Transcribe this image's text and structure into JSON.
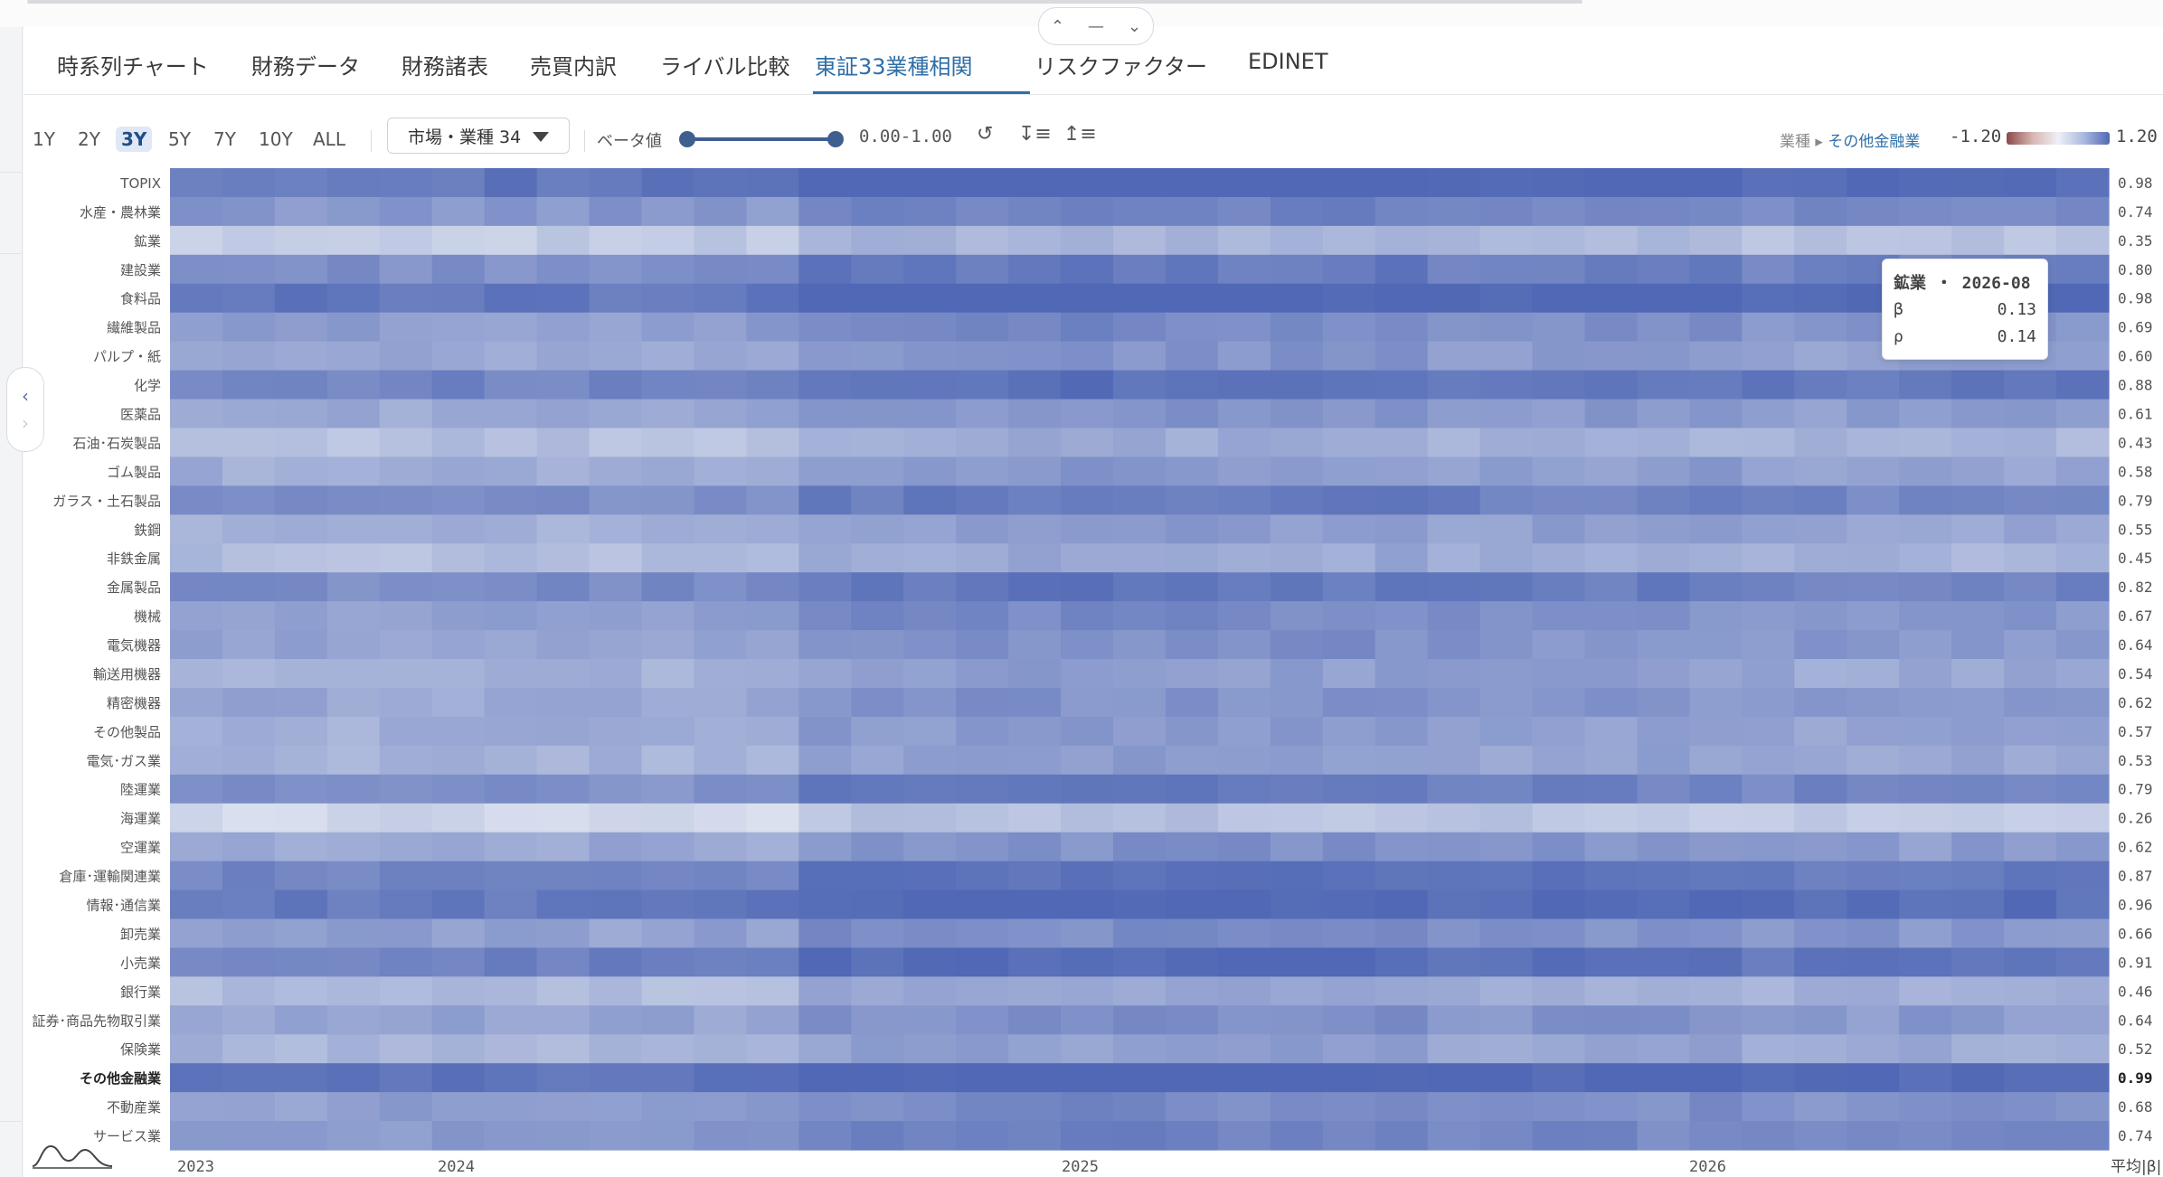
{
  "window": {
    "collapse_icons": [
      "chevron-up-icon",
      "dash-icon",
      "chevron-down-icon"
    ],
    "side_icons": [
      "chevron-left-icon",
      "chevron-right-icon"
    ]
  },
  "tabs": [
    {
      "label": "時系列チャート"
    },
    {
      "label": "財務データ"
    },
    {
      "label": "財務諸表"
    },
    {
      "label": "売買内訳"
    },
    {
      "label": "ライバル比較"
    },
    {
      "label": "東証33業種相関",
      "active": true
    },
    {
      "label": "リスクファクター"
    },
    {
      "label": "EDINET"
    }
  ],
  "toolbar": {
    "ranges": [
      "1Y",
      "2Y",
      "3Y",
      "5Y",
      "7Y",
      "10Y",
      "ALL"
    ],
    "active_range": "3Y",
    "market_select": "市場・業種 34",
    "beta_label": "ベータ値",
    "beta_range": [
      0.0,
      1.0
    ],
    "beta_range_text": "0.00-1.00",
    "icons": [
      "reset-icon",
      "sort-desc-icon",
      "sort-asc-icon"
    ],
    "legend_prefix": "業種",
    "legend_sector": "その他金融業",
    "legend_min": "-1.20",
    "legend_max": "1.20"
  },
  "tooltip": {
    "title": "鉱業 ・ 2026-08",
    "beta_label": "β",
    "beta_value": "0.13",
    "rho_label": "ρ",
    "rho_value": "0.14"
  },
  "chart_data": {
    "type": "heatmap",
    "xlabel_right": "平均|β|",
    "x_ticks": [
      "2023",
      "2024",
      "2025",
      "2026"
    ],
    "color_range": [
      -1.2,
      1.2
    ],
    "selected_row": "その他金融業",
    "rows": [
      {
        "label": "TOPIX",
        "mean": "0.98"
      },
      {
        "label": "水産・農林業",
        "mean": "0.74"
      },
      {
        "label": "鉱業",
        "mean": "0.35"
      },
      {
        "label": "建設業",
        "mean": "0.80"
      },
      {
        "label": "食料品",
        "mean": "0.98"
      },
      {
        "label": "繊維製品",
        "mean": "0.69"
      },
      {
        "label": "パルプ・紙",
        "mean": "0.60"
      },
      {
        "label": "化学",
        "mean": "0.88"
      },
      {
        "label": "医薬品",
        "mean": "0.61"
      },
      {
        "label": "石油･石炭製品",
        "mean": "0.43"
      },
      {
        "label": "ゴム製品",
        "mean": "0.58"
      },
      {
        "label": "ガラス・土石製品",
        "mean": "0.79"
      },
      {
        "label": "鉄鋼",
        "mean": "0.55"
      },
      {
        "label": "非鉄金属",
        "mean": "0.45"
      },
      {
        "label": "金属製品",
        "mean": "0.82"
      },
      {
        "label": "機械",
        "mean": "0.67"
      },
      {
        "label": "電気機器",
        "mean": "0.64"
      },
      {
        "label": "輸送用機器",
        "mean": "0.54"
      },
      {
        "label": "精密機器",
        "mean": "0.62"
      },
      {
        "label": "その他製品",
        "mean": "0.57"
      },
      {
        "label": "電気･ガス業",
        "mean": "0.53"
      },
      {
        "label": "陸運業",
        "mean": "0.79"
      },
      {
        "label": "海運業",
        "mean": "0.26"
      },
      {
        "label": "空運業",
        "mean": "0.62"
      },
      {
        "label": "倉庫･運輸関連業",
        "mean": "0.87"
      },
      {
        "label": "情報･通信業",
        "mean": "0.96"
      },
      {
        "label": "卸売業",
        "mean": "0.66"
      },
      {
        "label": "小売業",
        "mean": "0.91"
      },
      {
        "label": "銀行業",
        "mean": "0.46"
      },
      {
        "label": "証券･商品先物取引業",
        "mean": "0.64"
      },
      {
        "label": "保険業",
        "mean": "0.52"
      },
      {
        "label": "その他金融業",
        "mean": "0.99"
      },
      {
        "label": "不動産業",
        "mean": "0.68"
      },
      {
        "label": "サービス業",
        "mean": "0.74"
      }
    ]
  }
}
